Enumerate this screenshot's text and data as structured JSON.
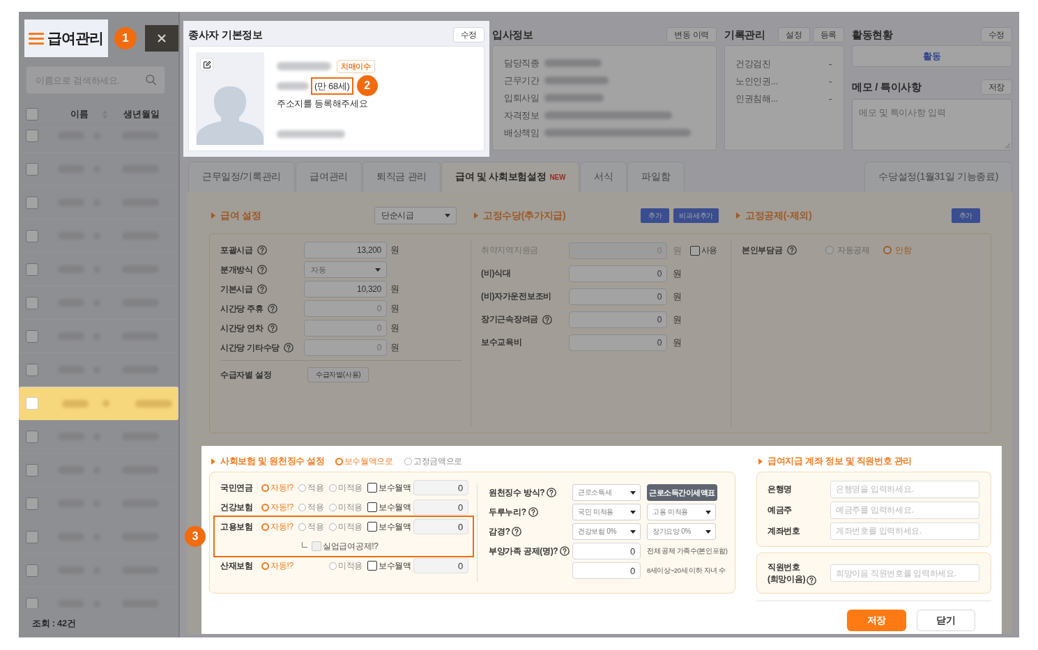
{
  "sidebar": {
    "title": "급여관리",
    "callout": "1",
    "search": {
      "placeholder": "이름으로 검색하세요."
    },
    "select_all": {
      "checked": false
    },
    "columns": [
      {
        "label": "이름",
        "sortable": true
      },
      {
        "label": "생년월일",
        "sortable": false
      }
    ],
    "rows": [
      {
        "selected": false,
        "checked": false
      },
      {
        "selected": false,
        "checked": false
      },
      {
        "selected": false,
        "checked": false
      },
      {
        "selected": false,
        "checked": false
      },
      {
        "selected": false,
        "checked": false
      },
      {
        "selected": false,
        "checked": false
      },
      {
        "selected": false,
        "checked": false
      },
      {
        "selected": false,
        "checked": false
      },
      {
        "selected": true,
        "checked": false
      },
      {
        "selected": false,
        "checked": false
      },
      {
        "selected": false,
        "checked": false
      },
      {
        "selected": false,
        "checked": false
      },
      {
        "selected": false,
        "checked": false
      },
      {
        "selected": false,
        "checked": false
      },
      {
        "selected": false,
        "checked": false
      }
    ],
    "footer": "조회 : 42건"
  },
  "employee_card": {
    "title": "종사자 기본정보",
    "button": "수정",
    "badge": "치매이수",
    "age": {
      "text": "(만 68세)",
      "highlighted": true,
      "callout": "2"
    },
    "address": "주소지를 등록해주세요"
  },
  "hire_info": {
    "title": "입사정보",
    "button": "변동 이력",
    "fields": [
      "담당직종",
      "근무기간",
      "입퇴사일",
      "자격정보",
      "배상책임"
    ]
  },
  "records": {
    "title": "기록관리",
    "buttons": [
      "설정",
      "등록"
    ],
    "items": [
      {
        "label": "건강검진",
        "value": "-"
      },
      {
        "label": "노인인권...",
        "value": "-"
      },
      {
        "label": "인권침해...",
        "value": "-"
      }
    ]
  },
  "activity": {
    "title": "활동현황",
    "button": "수정",
    "status": "활동"
  },
  "memo": {
    "title": "메모 / 특이사항",
    "button": "저장",
    "placeholder": "메모 및 특이사항 입력"
  },
  "tabs": [
    {
      "label": "근무일정/기록관리",
      "selected": false
    },
    {
      "label": "급여관리",
      "selected": false
    },
    {
      "label": "퇴직금 관리",
      "selected": false
    },
    {
      "label": "급여 및 사회보험설정",
      "badge": "NEW",
      "selected": true
    },
    {
      "label": "서식",
      "selected": false
    },
    {
      "label": "파일함",
      "selected": false
    }
  ],
  "side_tab": {
    "label": "수당설정(1월31일 기능종료)",
    "selected": false
  },
  "salary_settings": {
    "title": "급여 설정",
    "pay_type": "단순시급",
    "rows": [
      {
        "kind": "input",
        "label": "포괄시급",
        "help": true,
        "value": "13,200",
        "unit": "원",
        "readonly": false
      },
      {
        "kind": "select",
        "label": "분개방식",
        "help": true,
        "value": "자동",
        "readonly": true
      },
      {
        "kind": "input",
        "label": "기본시급",
        "help": true,
        "value": "10,320",
        "unit": "원",
        "readonly": false
      },
      {
        "kind": "input",
        "label": "시간당 주휴",
        "help": true,
        "value": "0",
        "unit": "원",
        "readonly": true
      },
      {
        "kind": "input",
        "label": "시간당 연차",
        "help": true,
        "value": "0",
        "unit": "원",
        "readonly": true
      },
      {
        "kind": "input",
        "label": "시간당 기타수당",
        "help": true,
        "value": "0",
        "unit": "원",
        "readonly": true
      }
    ],
    "per_recipient": {
      "label": "수급자별 설정",
      "button": "수급자별(사용)"
    }
  },
  "fixed_allowance": {
    "title": "고정수당(추가지급)",
    "buttons": [
      "추가",
      "비과세추가"
    ],
    "rows": [
      {
        "label": "취약지역지원금",
        "help": false,
        "value": "0",
        "unit": "원",
        "disabled": true,
        "option": {
          "label": "사용",
          "checked": false
        }
      },
      {
        "label": "(비)식대",
        "help": false,
        "value": "0",
        "unit": "원",
        "disabled": false
      },
      {
        "label": "(비)자가운전보조비",
        "help": false,
        "value": "0",
        "unit": "원",
        "disabled": false
      },
      {
        "label": "장기근속장려금",
        "help": true,
        "value": "0",
        "unit": "원",
        "disabled": false
      },
      {
        "label": "보수교육비",
        "help": false,
        "value": "0",
        "unit": "원",
        "disabled": false
      }
    ]
  },
  "fixed_deduction": {
    "title": "고정공제(-제외)",
    "button": "추가",
    "label": "본인부담금",
    "help": true,
    "options": [
      {
        "label": "자동공제",
        "selected": false
      },
      {
        "label": "안함",
        "selected": true
      }
    ]
  },
  "social_insurance": {
    "title": "사회보험 및 원천징수 설정",
    "basis": [
      {
        "label": "보수월액으로",
        "selected": true
      },
      {
        "label": "고정금액으로",
        "selected": false
      }
    ],
    "rows": [
      {
        "label": "국민연금",
        "options": [
          {
            "kind": "auto",
            "label": "자동!?",
            "selected": true
          },
          {
            "kind": "apply",
            "label": "적용",
            "selected": false
          },
          {
            "kind": "exempt",
            "label": "미적용",
            "selected": false
          }
        ],
        "monthly": {
          "label": "보수월액",
          "checked": false
        },
        "value": "0",
        "highlighted": false
      },
      {
        "label": "건강보험",
        "options": [
          {
            "kind": "auto",
            "label": "자동!?",
            "selected": true
          },
          {
            "kind": "apply",
            "label": "적용",
            "selected": false
          },
          {
            "kind": "exempt",
            "label": "미적용",
            "selected": false
          }
        ],
        "monthly": {
          "label": "보수월액",
          "checked": false
        },
        "value": "0",
        "highlighted": false
      },
      {
        "label": "고용보험",
        "options": [
          {
            "kind": "auto",
            "label": "자동!?",
            "selected": true
          },
          {
            "kind": "apply",
            "label": "적용",
            "selected": false
          },
          {
            "kind": "exempt",
            "label": "미적용",
            "selected": false
          }
        ],
        "monthly": {
          "label": "보수월액",
          "checked": false
        },
        "value": "0",
        "highlighted": true,
        "callout": "3",
        "sub": {
          "label": "실업급여공제!?",
          "checked": false,
          "disabled": true
        }
      },
      {
        "label": "산재보험",
        "options": [
          {
            "kind": "auto",
            "label": "자동!?",
            "selected": true
          },
          {
            "kind": "exempt",
            "label": "미적용",
            "selected": false
          }
        ],
        "monthly": {
          "label": "보수월액",
          "checked": false
        },
        "value": "0",
        "highlighted": false
      }
    ],
    "withholding": [
      {
        "label": "원천징수 방식?",
        "help": true,
        "fields": [
          {
            "kind": "select",
            "value": "근로소득세"
          },
          {
            "kind": "button",
            "label": "근로소득간이세액표"
          }
        ]
      },
      {
        "label": "두루누리?",
        "help": true,
        "fields": [
          {
            "kind": "select",
            "value": "국민 미적용"
          },
          {
            "kind": "select",
            "value": "고용 미적용"
          }
        ]
      },
      {
        "label": "감경?",
        "help": true,
        "fields": [
          {
            "kind": "select",
            "value": "건강보험 0%"
          },
          {
            "kind": "select",
            "value": "장기요양 0%"
          }
        ]
      },
      {
        "label": "부양가족 공제(명)?",
        "help": true,
        "fields": [
          {
            "kind": "input",
            "value": "0"
          },
          {
            "kind": "note",
            "text": "전체 공제 가족수(본인포함)"
          }
        ]
      },
      {
        "fields": [
          {
            "kind": "input",
            "value": "0"
          },
          {
            "kind": "note",
            "text": "8세이상~20세 이하 자녀 수"
          }
        ]
      }
    ]
  },
  "bank": {
    "title": "급여지급 계좌 정보 및 직원번호 관리",
    "fields": [
      {
        "label": "은행명",
        "placeholder": "은행명을 입력하세요."
      },
      {
        "label": "예금주",
        "placeholder": "예금주를 입력하세요."
      },
      {
        "label": "계좌번호",
        "placeholder": "계좌번호를 입력하세요."
      }
    ],
    "employee_no": {
      "label": "직원번호\n(희망이음)",
      "help": true,
      "placeholder": "희망이음 직원번호를 입력하세요."
    }
  },
  "actions": [
    {
      "kind": "save",
      "label": "저장"
    },
    {
      "kind": "close",
      "label": "닫기"
    }
  ]
}
